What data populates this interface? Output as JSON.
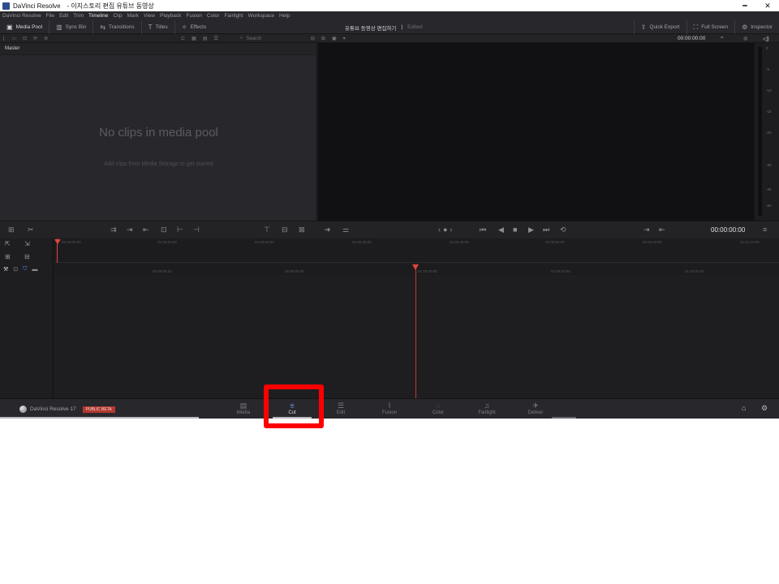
{
  "window": {
    "app_name": "DaVinci Resolve",
    "document_title": "- 이지스토리 편집 유튜브 동영상",
    "minimize": "━",
    "close": "✕"
  },
  "menu": [
    "DaVinci Resolve",
    "File",
    "Edit",
    "Trim",
    "Timeline",
    "Clip",
    "Mark",
    "View",
    "Playback",
    "Fusion",
    "Color",
    "Fairlight",
    "Workspace",
    "Help"
  ],
  "toolbar": {
    "media_pool": "Media Pool",
    "sync_bin": "Sync Bin",
    "transitions": "Transitions",
    "titles": "Titles",
    "effects": "Effects",
    "project_title": "유튜브 동영상 편집하기",
    "edited": "Edited",
    "quick_export": "Quick Export",
    "full_screen": "Full Screen",
    "inspector": "Inspector"
  },
  "subtoolbar": {
    "search_placeholder": "Search",
    "timecode": "00:00:00:00"
  },
  "media_pool": {
    "bin_name": "Master",
    "empty_title": "No clips in media pool",
    "empty_hint": "Add clips from Media Storage to get started"
  },
  "meter": {
    "ticks": [
      "0",
      "-5",
      "-10",
      "-15",
      "-20",
      "-30",
      "-40",
      "-50"
    ]
  },
  "transport": {
    "timecode": "00:00:00:00"
  },
  "ruler_top": [
    "01:00:00:00",
    "01:00:10:00",
    "01:00:20:00",
    "01:00:30:00",
    "01:00:40:00",
    "01:00:50:00",
    "01:01:00:00",
    "01:01:10:00"
  ],
  "ruler_bottom": [
    "00:59:55:00",
    "00:59:58:00",
    "01:00:00:00",
    "01:00:02:00",
    "01:00:04:00"
  ],
  "footer": {
    "brand": "DaVinci Resolve 17",
    "beta": "PUBLIC BETA"
  },
  "pages": [
    {
      "label": "Media",
      "icon": "▤"
    },
    {
      "label": "Cut",
      "icon": "⩸"
    },
    {
      "label": "Edit",
      "icon": "☰"
    },
    {
      "label": "Fusion",
      "icon": "⌇"
    },
    {
      "label": "Color",
      "icon": "◌"
    },
    {
      "label": "Fairlight",
      "icon": "♫"
    },
    {
      "label": "Deliver",
      "icon": "✈"
    }
  ],
  "active_page": "Cut",
  "colors": {
    "playhead": "#e0463a",
    "highlight": "#ff0000",
    "beta_badge": "#b2382f",
    "cut_icon": "#6ea7ff"
  }
}
